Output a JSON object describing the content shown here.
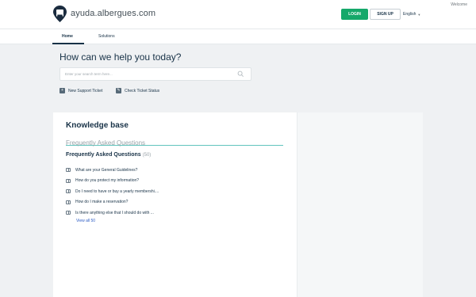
{
  "header": {
    "site_name": "ayuda.albergues.com",
    "welcome": "Welcome",
    "login_label": "LOGIN",
    "signup_label": "SIGN UP",
    "language": "English",
    "brand_color": "#15a86a"
  },
  "nav": {
    "tabs": [
      {
        "label": "Home",
        "active": true
      },
      {
        "label": "Solutions",
        "active": false
      }
    ]
  },
  "hero": {
    "title": "How can we help you today?",
    "search_placeholder": "Enter your search term here...",
    "actions": [
      {
        "label": "New Support Ticket",
        "icon": "plus-icon"
      },
      {
        "label": "Check Ticket Status",
        "icon": "ticket-status-icon"
      }
    ]
  },
  "knowledge_base": {
    "title": "Knowledge base",
    "category": "Frequently Asked Questions",
    "section_title": "Frequently Asked Questions",
    "section_count": "(50)",
    "articles": [
      "What are your General Guidelines?",
      "How do you protect my information?",
      "Do I need to have or buy a yearly membershi....",
      "How do I make a reservation?",
      "Is there anything else that I should do with ..."
    ],
    "view_all": "View all 50"
  }
}
